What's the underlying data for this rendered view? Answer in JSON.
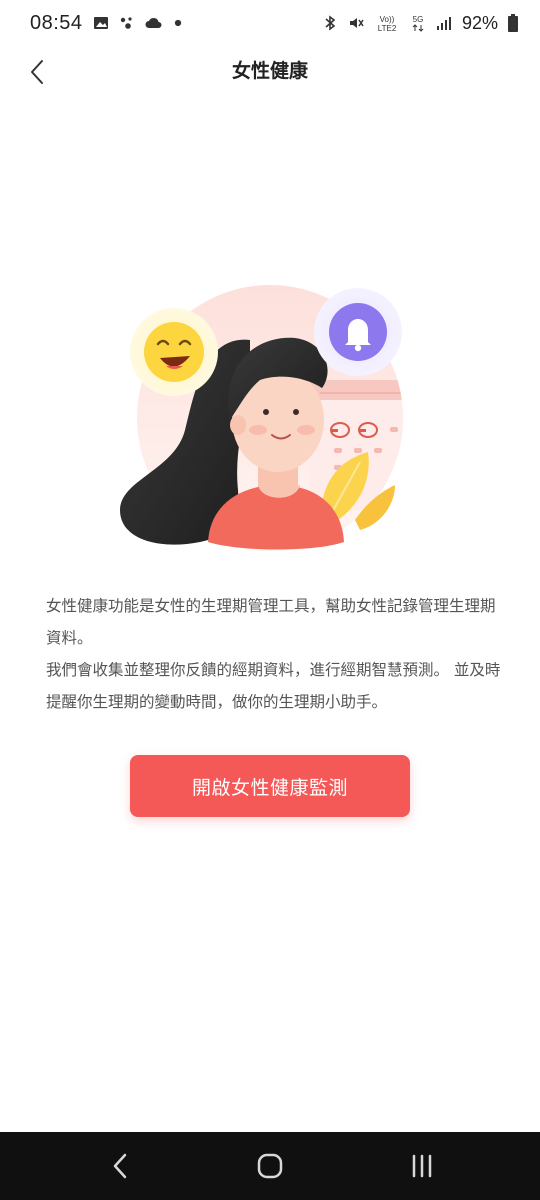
{
  "status_bar": {
    "time": "08:54",
    "battery_percent": "92%",
    "icons": [
      "gallery-icon",
      "assistant-icon",
      "cloud-icon",
      "dot-icon",
      "bluetooth-icon",
      "mute-icon",
      "volte-icon",
      "5g-icon",
      "signal-icon",
      "battery-icon"
    ],
    "volte_label": "Vo)) LTE2",
    "network_label": "5G"
  },
  "header": {
    "title": "女性健康",
    "back_icon": "back-chevron-icon"
  },
  "illustration": {
    "name": "woman-with-emoji-bell-calendar-illustration",
    "colors": {
      "circle_bg": "#fde6e2",
      "hair": "#2b2b2b",
      "shirt": "#f26a5c",
      "skin": "#fbd5c4",
      "emoji": "#fcd53f",
      "bell_bg": "#8d78ee",
      "leaf": "#fcd34d"
    }
  },
  "description": {
    "paragraph1": "女性健康功能是女性的生理期管理工具，幫助女性記錄管理生理期資料。",
    "paragraph2": "我們會收集並整理你反饋的經期資料，進行經期智慧預測。 並及時提醒你生理期的變動時間，做你的生理期小助手。"
  },
  "cta": {
    "label": "開啟女性健康監測",
    "color": "#f45857"
  },
  "nav_bar": {
    "icons": [
      "nav-back-icon",
      "nav-home-icon",
      "nav-recent-apps-icon"
    ]
  }
}
